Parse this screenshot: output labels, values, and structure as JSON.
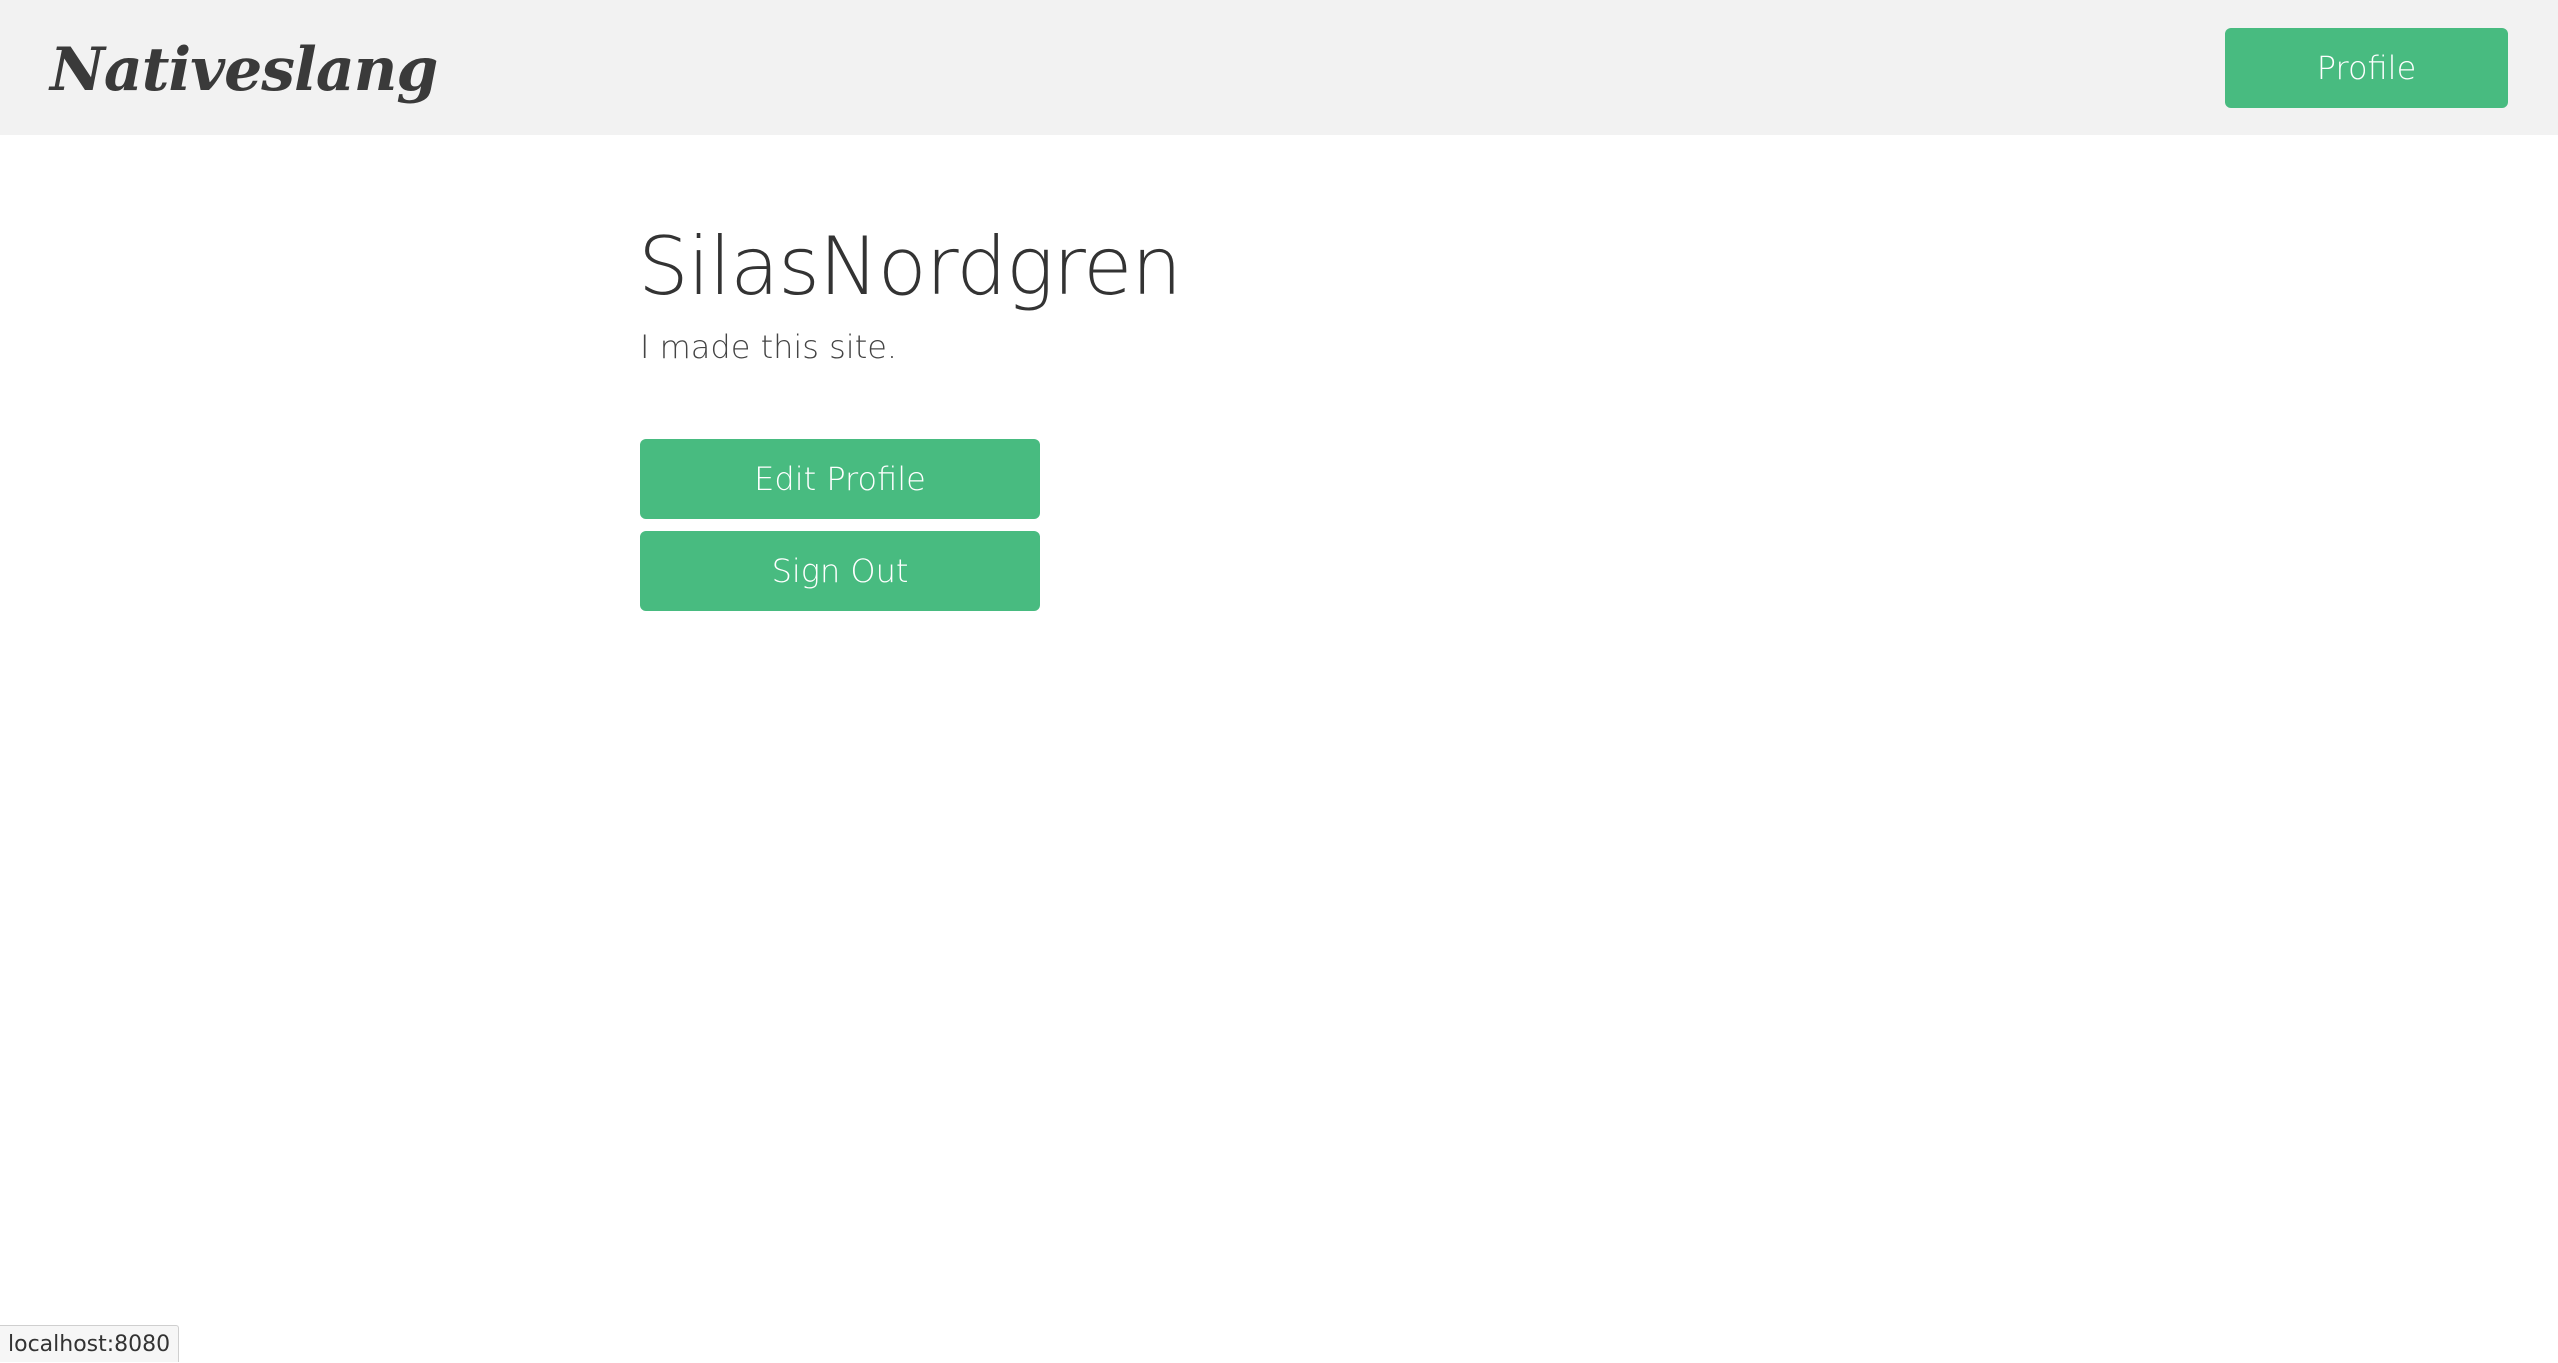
{
  "header": {
    "logo_text": "Nativeslang",
    "profile_button_label": "Profile"
  },
  "profile": {
    "username": "SilasNordgren",
    "bio": "I made this site.",
    "edit_button_label": "Edit Profile",
    "signout_button_label": "Sign Out"
  },
  "status_bar": {
    "url": "localhost:8080"
  },
  "colors": {
    "accent": "#48bb80",
    "header_bg": "#f2f2f2",
    "text": "#333333"
  }
}
